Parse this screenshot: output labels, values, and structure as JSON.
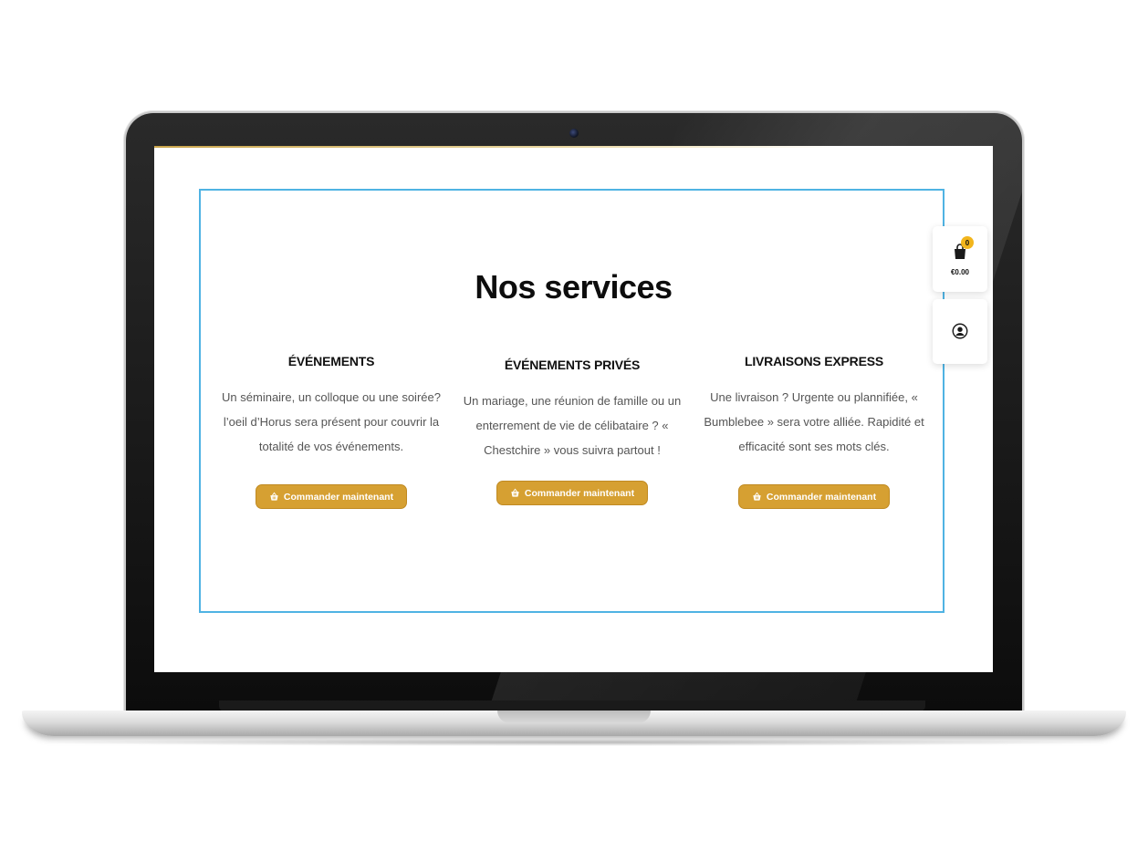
{
  "section": {
    "title": "Nos services"
  },
  "services": [
    {
      "title": "ÉVÉNEMENTS",
      "description": "Un séminaire, un colloque ou une soirée? l’oeil d’Horus sera présent pour couvrir la totalité de vos événements.",
      "button_label": "Commander maintenant"
    },
    {
      "title": "ÉVÉNEMENTS PRIVÉS",
      "description": "Un mariage, une réunion de famille ou un enterrement de vie de célibataire ? « Chestchire » vous suivra partout !",
      "button_label": "Commander maintenant"
    },
    {
      "title": "LIVRAISONS EXPRESS",
      "description": "Une livraison ? Urgente ou plannifiée, « Bumblebee » sera votre alliée. Rapidité et efficacité sont ses mots clés.",
      "button_label": "Commander maintenant"
    }
  ],
  "cart": {
    "count": "0",
    "total": "€0.00",
    "icon": "shopping-bag-icon"
  },
  "account": {
    "icon": "user-circle-icon"
  },
  "colors": {
    "accent": "#d6a032",
    "frame_border": "#4fb3e3",
    "badge": "#f2b51c"
  }
}
